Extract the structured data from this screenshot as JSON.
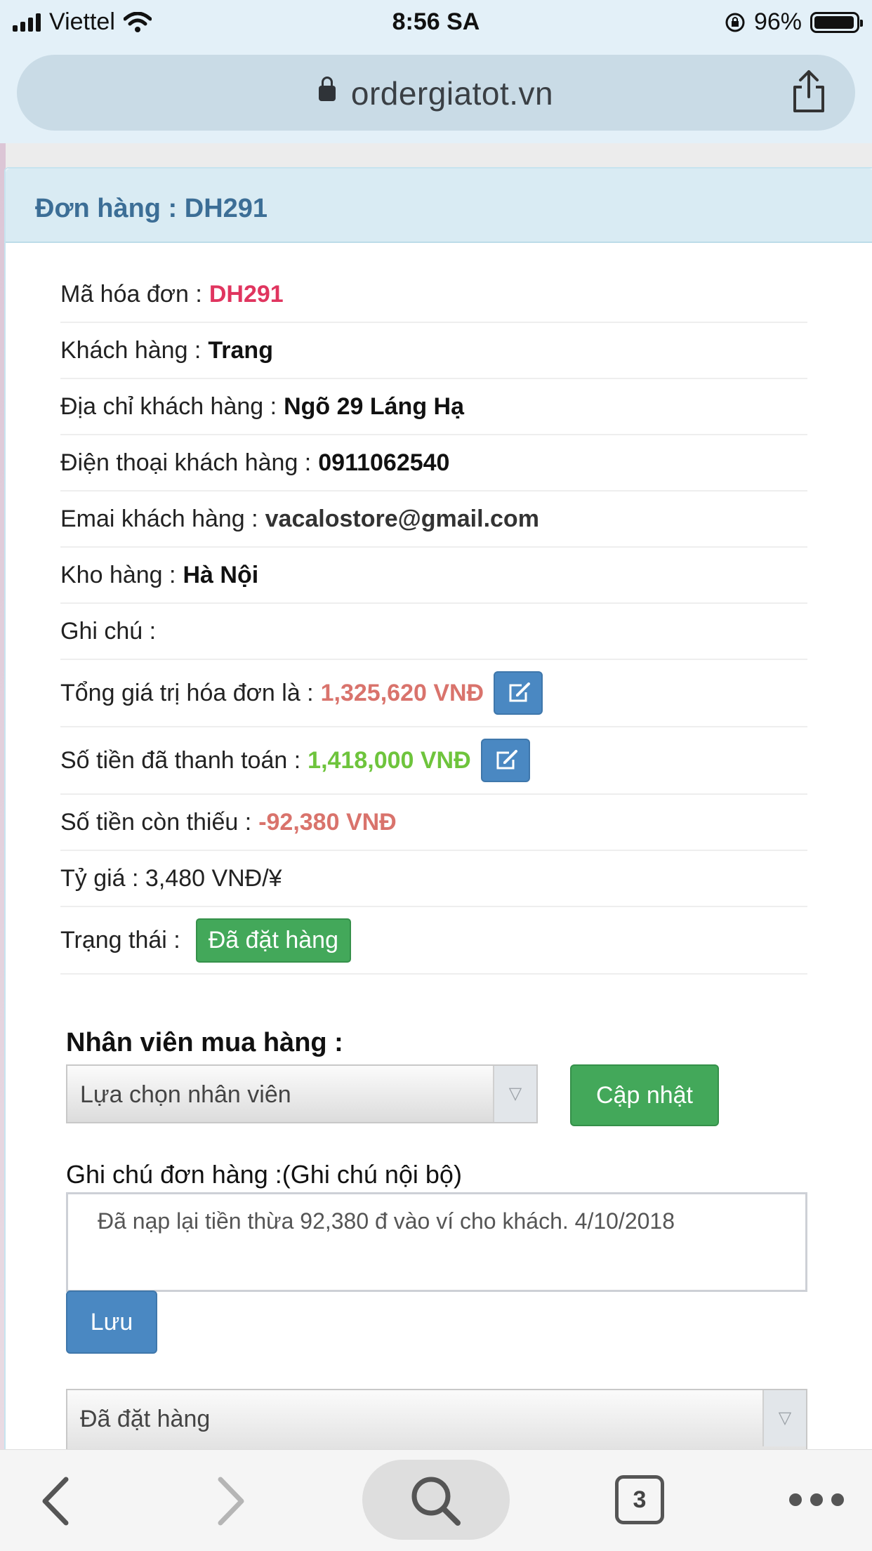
{
  "status_bar": {
    "carrier": "Viettel",
    "time": "8:56 SA",
    "battery": "96%",
    "battery_level": 0.96
  },
  "browser": {
    "url": "ordergiatot.vn",
    "tab_count": "3"
  },
  "order": {
    "panel_title": "Đơn hàng : DH291",
    "fields": {
      "invoice_label": "Mã hóa đơn :",
      "invoice_value": "DH291",
      "customer_label": "Khách hàng :",
      "customer_value": "Trang",
      "address_label": "Địa chỉ khách hàng :",
      "address_value": "Ngõ 29 Láng Hạ",
      "phone_label": "Điện thoại khách hàng :",
      "phone_value": "0911062540",
      "email_label": "Emai khách hàng :",
      "email_value": "vacalostore@gmail.com",
      "warehouse_label": "Kho hàng :",
      "warehouse_value": "Hà Nội",
      "note_label": "Ghi chú :",
      "note_value": "",
      "total_label": "Tổng giá trị hóa đơn là :",
      "total_value": "1,325,620 VNĐ",
      "paid_label": "Số tiền đã thanh toán :",
      "paid_value": "1,418,000 VNĐ",
      "remaining_label": "Số tiền còn thiếu :",
      "remaining_value": "-92,380 VNĐ",
      "rate_text": "Tỷ giá : 3,480 VNĐ/¥",
      "status_label": "Trạng thái :",
      "status_value": "Đã đặt hàng"
    },
    "buyer": {
      "section_title": "Nhân viên mua hàng :",
      "select_value": "Lựa chọn nhân viên",
      "update_button": "Cập nhật"
    },
    "internal_note": {
      "label": "Ghi chú đơn hàng :(Ghi chú nội bộ)",
      "value": "Đã nạp lại tiền thừa 92,380 đ vào ví cho khách. 4/10/2018",
      "save_button": "Lưu"
    },
    "status_select_value": "Đã đặt hàng"
  },
  "colors": {
    "accent_blue": "#4a88c2",
    "success_green": "#43a85a",
    "invoice_red": "#e0355f",
    "amount_salmon": "#d9736c",
    "paid_green": "#6ec43c",
    "panel_title": "#3c6e96"
  },
  "icons": [
    "signal-icon",
    "wifi-icon",
    "rotation-lock-icon",
    "battery-icon",
    "lock-icon",
    "share-icon",
    "edit-icon",
    "chevron-down-icon",
    "back-icon",
    "forward-icon",
    "search-icon",
    "tabs-icon",
    "more-icon"
  ]
}
